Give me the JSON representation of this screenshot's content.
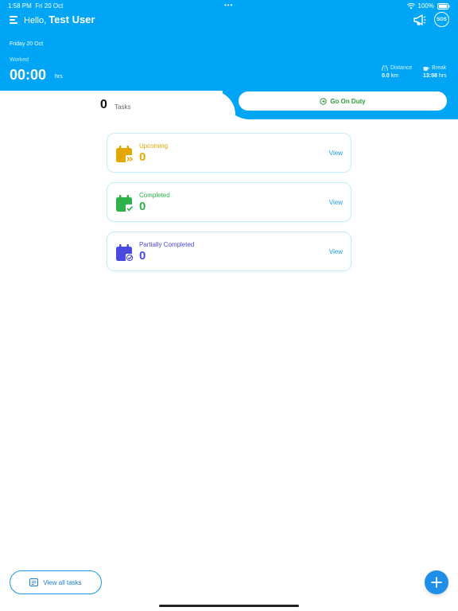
{
  "status_bar": {
    "time": "1:58 PM",
    "date": "Fri 20 Oct",
    "battery": "100%"
  },
  "header": {
    "greeting": "Hello,",
    "user_name": "Test User",
    "sos_label": "SOS"
  },
  "summary": {
    "date": "Friday 20 Oct",
    "worked_label": "Worked",
    "worked_value": "00:00",
    "worked_unit": "hrs",
    "distance_label": "Distance",
    "distance_value": "0.0",
    "distance_unit": "km",
    "break_label": "Break",
    "break_value": "13:58",
    "break_unit": "hrs"
  },
  "tasks": {
    "count": "0",
    "label": "Tasks"
  },
  "duty_button": {
    "label": "Go On Duty",
    "color": "#2e9e3e"
  },
  "cards": [
    {
      "title": "Upcoming",
      "count": "0",
      "view": "View",
      "color": "#e0a800"
    },
    {
      "title": "Completed",
      "count": "0",
      "view": "View",
      "color": "#2eb34c"
    },
    {
      "title": "Partially Completed",
      "count": "0",
      "view": "View",
      "color": "#4a4ae0"
    }
  ],
  "footer": {
    "view_all_label": "View all tasks"
  },
  "colors": {
    "primary": "#00a6f5",
    "fab": "#1f8ee8"
  }
}
